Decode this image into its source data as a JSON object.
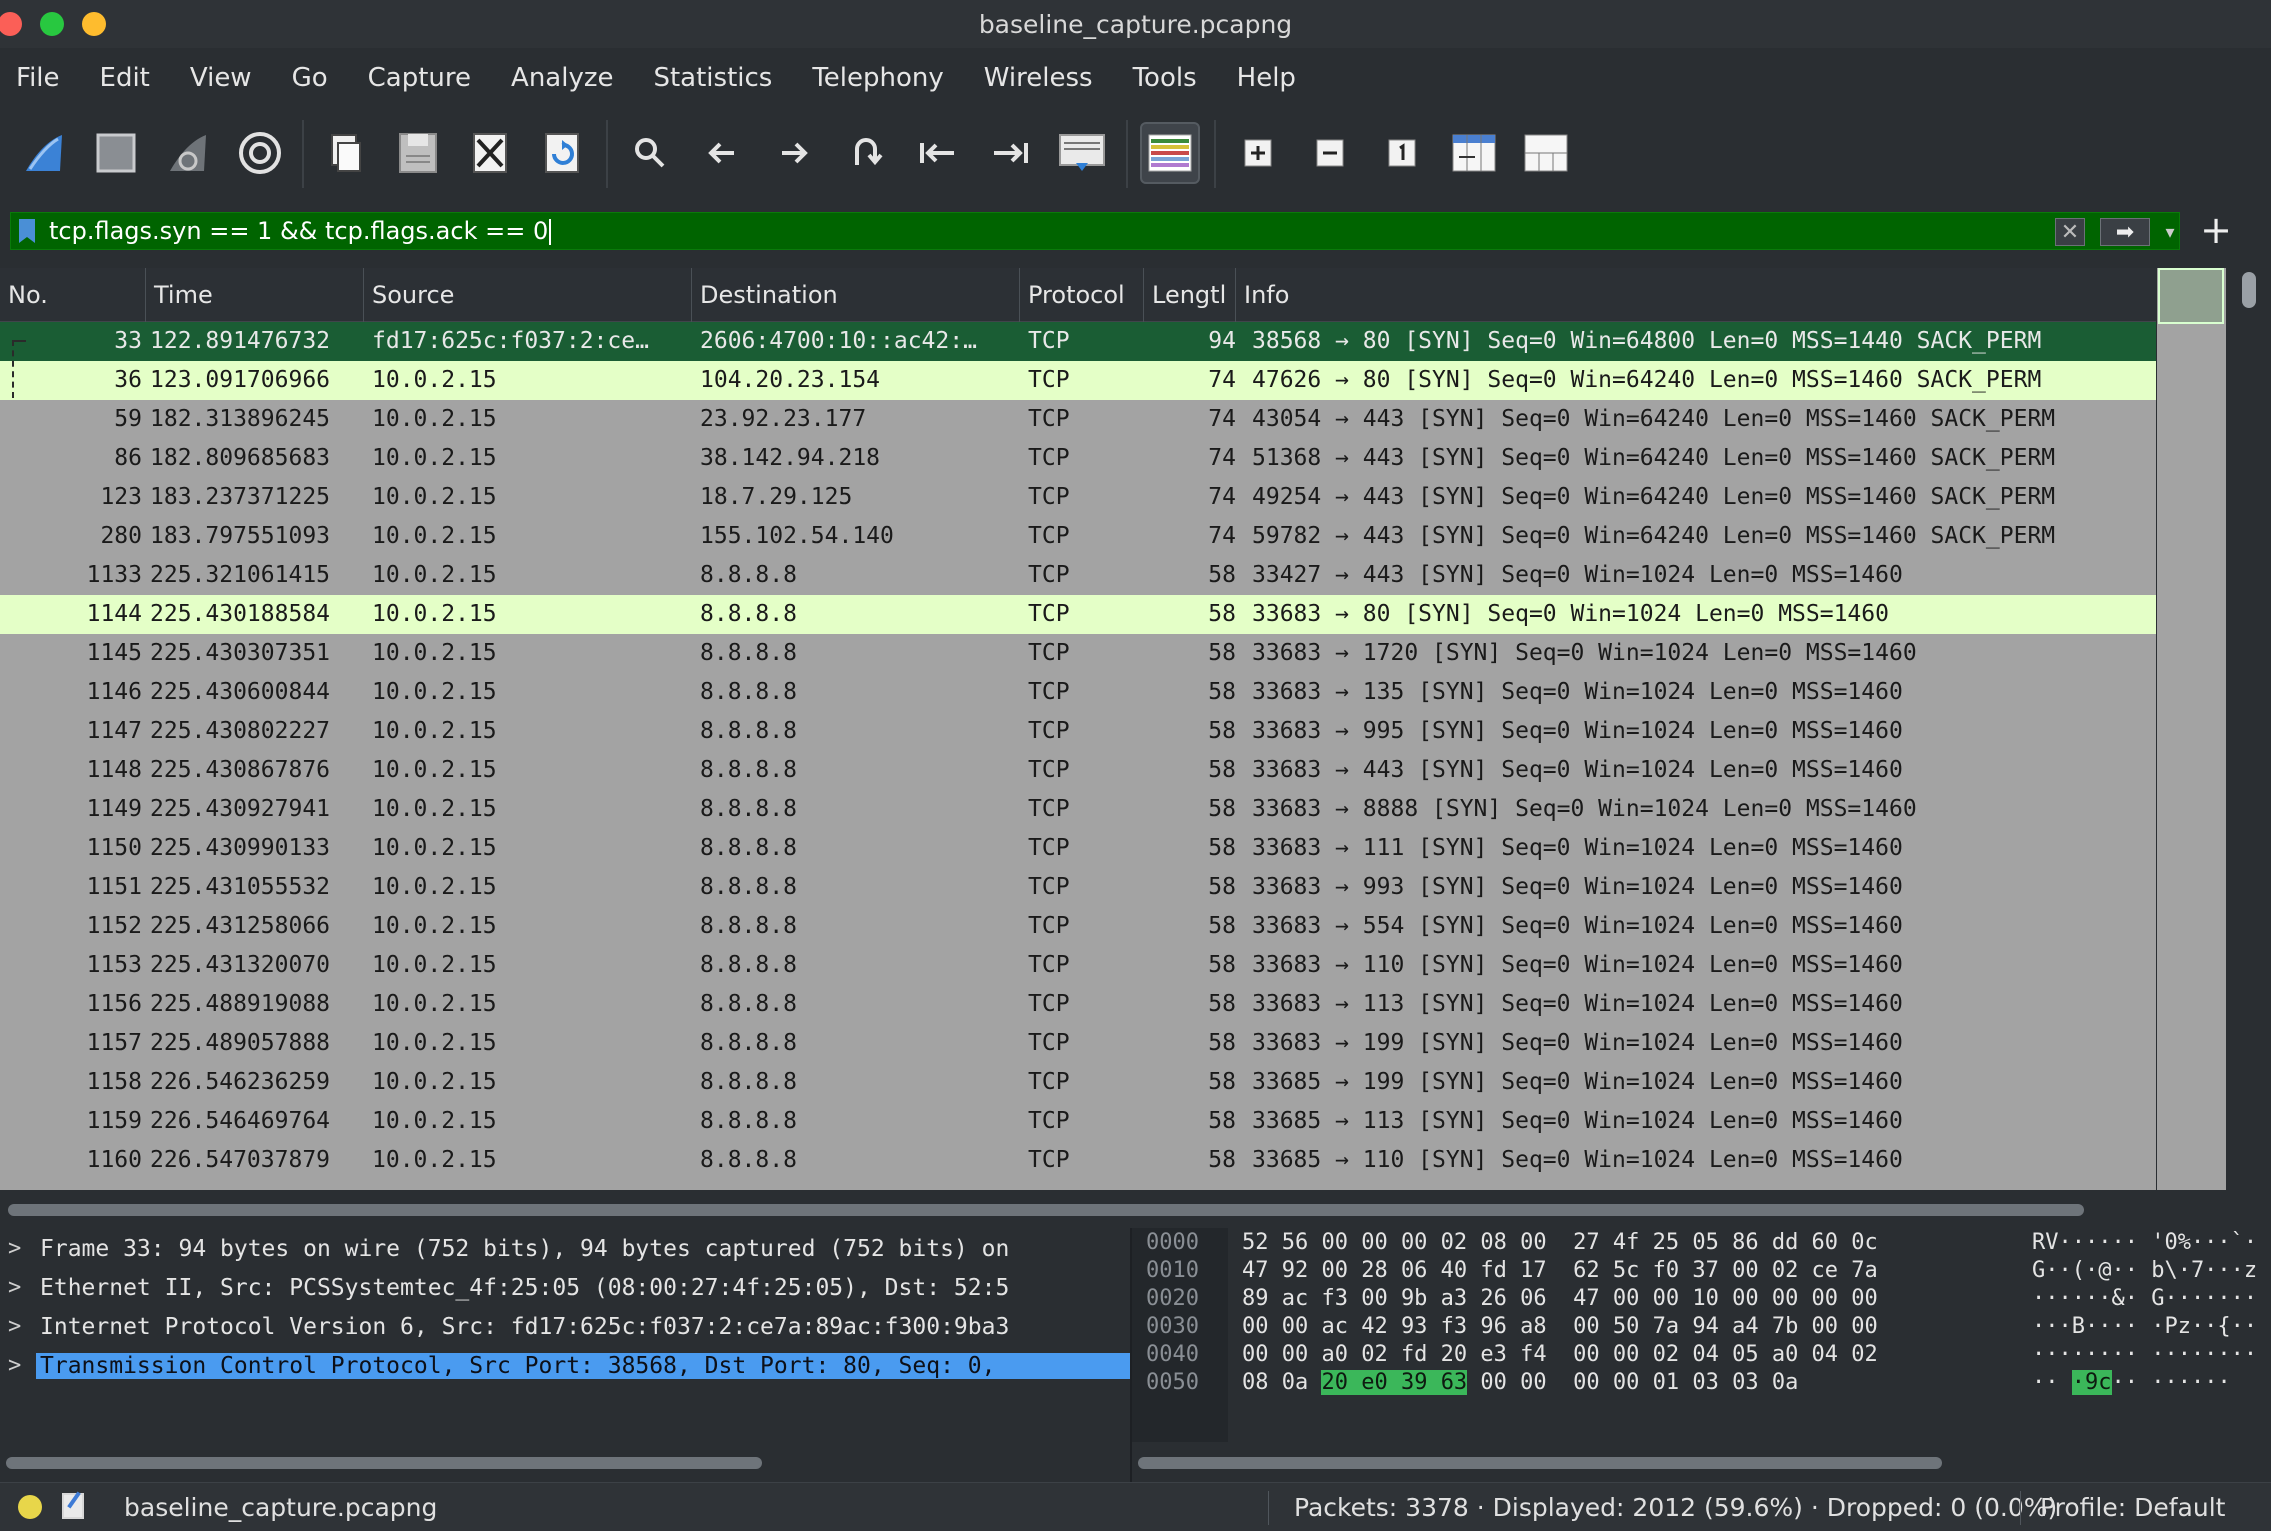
{
  "window": {
    "title": "baseline_capture.pcapng"
  },
  "menu": [
    "File",
    "Edit",
    "View",
    "Go",
    "Capture",
    "Analyze",
    "Statistics",
    "Telephony",
    "Wireless",
    "Tools",
    "Help"
  ],
  "toolbar": {
    "icons": [
      "shark-fin-start-icon",
      "stop-square-icon",
      "shark-fin-restart-icon",
      "gear-options-icon",
      "open-file-icon",
      "save-file-icon",
      "close-file-icon",
      "reload-file-icon",
      "search-icon",
      "arrow-left-icon",
      "arrow-right-icon",
      "go-to-packet-icon",
      "first-packet-icon",
      "last-packet-icon",
      "autoscroll-icon",
      "colorize-icon",
      "zoom-in-icon",
      "zoom-out-icon",
      "normal-size-icon",
      "resize-columns-icon",
      "layout-icon"
    ]
  },
  "filter": {
    "value": "tcp.flags.syn == 1 && tcp.flags.ack == 0"
  },
  "packet_list": {
    "columns": [
      "No.",
      "Time",
      "Source",
      "Destination",
      "Protocol",
      "Lengtl",
      "Info"
    ],
    "rows": [
      {
        "no": "33",
        "time": "122.891476732",
        "src": "fd17:625c:f037:2:ce…",
        "dst": "2606:4700:10::ac42:…",
        "proto": "TCP",
        "len": "94",
        "info": "38568 → 80 [SYN] Seq=0 Win=64800 Len=0 MSS=1440 SACK_PERM"
      },
      {
        "no": "36",
        "time": "123.091706966",
        "src": "10.0.2.15",
        "dst": "104.20.23.154",
        "proto": "TCP",
        "len": "74",
        "info": "47626 → 80 [SYN] Seq=0 Win=64240 Len=0 MSS=1460 SACK_PERM"
      },
      {
        "no": "59",
        "time": "182.313896245",
        "src": "10.0.2.15",
        "dst": "23.92.23.177",
        "proto": "TCP",
        "len": "74",
        "info": "43054 → 443 [SYN] Seq=0 Win=64240 Len=0 MSS=1460 SACK_PERM"
      },
      {
        "no": "86",
        "time": "182.809685683",
        "src": "10.0.2.15",
        "dst": "38.142.94.218",
        "proto": "TCP",
        "len": "74",
        "info": "51368 → 443 [SYN] Seq=0 Win=64240 Len=0 MSS=1460 SACK_PERM"
      },
      {
        "no": "123",
        "time": "183.237371225",
        "src": "10.0.2.15",
        "dst": "18.7.29.125",
        "proto": "TCP",
        "len": "74",
        "info": "49254 → 443 [SYN] Seq=0 Win=64240 Len=0 MSS=1460 SACK_PERM"
      },
      {
        "no": "280",
        "time": "183.797551093",
        "src": "10.0.2.15",
        "dst": "155.102.54.140",
        "proto": "TCP",
        "len": "74",
        "info": "59782 → 443 [SYN] Seq=0 Win=64240 Len=0 MSS=1460 SACK_PERM"
      },
      {
        "no": "1133",
        "time": "225.321061415",
        "src": "10.0.2.15",
        "dst": "8.8.8.8",
        "proto": "TCP",
        "len": "58",
        "info": "33427 → 443 [SYN] Seq=0 Win=1024 Len=0 MSS=1460"
      },
      {
        "no": "1144",
        "time": "225.430188584",
        "src": "10.0.2.15",
        "dst": "8.8.8.8",
        "proto": "TCP",
        "len": "58",
        "info": "33683 → 80 [SYN] Seq=0 Win=1024 Len=0 MSS=1460"
      },
      {
        "no": "1145",
        "time": "225.430307351",
        "src": "10.0.2.15",
        "dst": "8.8.8.8",
        "proto": "TCP",
        "len": "58",
        "info": "33683 → 1720 [SYN] Seq=0 Win=1024 Len=0 MSS=1460"
      },
      {
        "no": "1146",
        "time": "225.430600844",
        "src": "10.0.2.15",
        "dst": "8.8.8.8",
        "proto": "TCP",
        "len": "58",
        "info": "33683 → 135 [SYN] Seq=0 Win=1024 Len=0 MSS=1460"
      },
      {
        "no": "1147",
        "time": "225.430802227",
        "src": "10.0.2.15",
        "dst": "8.8.8.8",
        "proto": "TCP",
        "len": "58",
        "info": "33683 → 995 [SYN] Seq=0 Win=1024 Len=0 MSS=1460"
      },
      {
        "no": "1148",
        "time": "225.430867876",
        "src": "10.0.2.15",
        "dst": "8.8.8.8",
        "proto": "TCP",
        "len": "58",
        "info": "33683 → 443 [SYN] Seq=0 Win=1024 Len=0 MSS=1460"
      },
      {
        "no": "1149",
        "time": "225.430927941",
        "src": "10.0.2.15",
        "dst": "8.8.8.8",
        "proto": "TCP",
        "len": "58",
        "info": "33683 → 8888 [SYN] Seq=0 Win=1024 Len=0 MSS=1460"
      },
      {
        "no": "1150",
        "time": "225.430990133",
        "src": "10.0.2.15",
        "dst": "8.8.8.8",
        "proto": "TCP",
        "len": "58",
        "info": "33683 → 111 [SYN] Seq=0 Win=1024 Len=0 MSS=1460"
      },
      {
        "no": "1151",
        "time": "225.431055532",
        "src": "10.0.2.15",
        "dst": "8.8.8.8",
        "proto": "TCP",
        "len": "58",
        "info": "33683 → 993 [SYN] Seq=0 Win=1024 Len=0 MSS=1460"
      },
      {
        "no": "1152",
        "time": "225.431258066",
        "src": "10.0.2.15",
        "dst": "8.8.8.8",
        "proto": "TCP",
        "len": "58",
        "info": "33683 → 554 [SYN] Seq=0 Win=1024 Len=0 MSS=1460"
      },
      {
        "no": "1153",
        "time": "225.431320070",
        "src": "10.0.2.15",
        "dst": "8.8.8.8",
        "proto": "TCP",
        "len": "58",
        "info": "33683 → 110 [SYN] Seq=0 Win=1024 Len=0 MSS=1460"
      },
      {
        "no": "1156",
        "time": "225.488919088",
        "src": "10.0.2.15",
        "dst": "8.8.8.8",
        "proto": "TCP",
        "len": "58",
        "info": "33683 → 113 [SYN] Seq=0 Win=1024 Len=0 MSS=1460"
      },
      {
        "no": "1157",
        "time": "225.489057888",
        "src": "10.0.2.15",
        "dst": "8.8.8.8",
        "proto": "TCP",
        "len": "58",
        "info": "33683 → 199 [SYN] Seq=0 Win=1024 Len=0 MSS=1460"
      },
      {
        "no": "1158",
        "time": "226.546236259",
        "src": "10.0.2.15",
        "dst": "8.8.8.8",
        "proto": "TCP",
        "len": "58",
        "info": "33685 → 199 [SYN] Seq=0 Win=1024 Len=0 MSS=1460"
      },
      {
        "no": "1159",
        "time": "226.546469764",
        "src": "10.0.2.15",
        "dst": "8.8.8.8",
        "proto": "TCP",
        "len": "58",
        "info": "33685 → 113 [SYN] Seq=0 Win=1024 Len=0 MSS=1460"
      },
      {
        "no": "1160",
        "time": "226.547037879",
        "src": "10.0.2.15",
        "dst": "8.8.8.8",
        "proto": "TCP",
        "len": "58",
        "info": "33685 → 110 [SYN] Seq=0 Win=1024 Len=0 MSS=1460"
      }
    ]
  },
  "details": [
    {
      "text": "Frame 33: 94 bytes on wire (752 bits), 94 bytes captured (752 bits) on"
    },
    {
      "text": "Ethernet II, Src: PCSSystemtec_4f:25:05 (08:00:27:4f:25:05), Dst: 52:5"
    },
    {
      "text": "Internet Protocol Version 6, Src: fd17:625c:f037:2:ce7a:89ac:f300:9ba3"
    },
    {
      "text": "Transmission Control Protocol, Src Port: 38568, Dst Port: 80, Seq: 0,"
    }
  ],
  "bytes": [
    {
      "offset": "0000",
      "hex1": "52 56 00 00 00 02 08 00",
      "hex2": "27 4f 25 05 86 dd 60 0c",
      "ascii": "RV······ '0%···`·"
    },
    {
      "offset": "0010",
      "hex1": "47 92 00 28 06 40 fd 17",
      "hex2": "62 5c f0 37 00 02 ce 7a",
      "ascii": "G··(·@·· b\\·7···z"
    },
    {
      "offset": "0020",
      "hex1": "89 ac f3 00 9b a3 26 06",
      "hex2": "47 00 00 10 00 00 00 00",
      "ascii": "······&· G·······"
    },
    {
      "offset": "0030",
      "hex1": "00 00 ac 42 93 f3 96 a8",
      "hex2": "00 50 7a 94 a4 7b 00 00",
      "ascii": "···B···· ·Pz··{··"
    },
    {
      "offset": "0040",
      "hex1": "00 00 a0 02 fd 20 e3 f4",
      "hex2": "00 00 02 04 05 a0 04 02",
      "ascii": "········ ········"
    },
    {
      "offset": "0050",
      "hex1_pre": "08 0a ",
      "hex1_hl": "20 e0 39 63",
      "hex1_post": " 00 00",
      "hex2": "00 00 01 03 03 0a",
      "ascii_pre": "·· ",
      "ascii_hl": "·9c",
      "ascii_post": "·· ······"
    }
  ],
  "status": {
    "file": "baseline_capture.pcapng",
    "packets": "Packets: 3378 · Displayed: 2012 (59.6%) · Dropped: 0 (0.0%)",
    "profile": "Profile: Default"
  }
}
